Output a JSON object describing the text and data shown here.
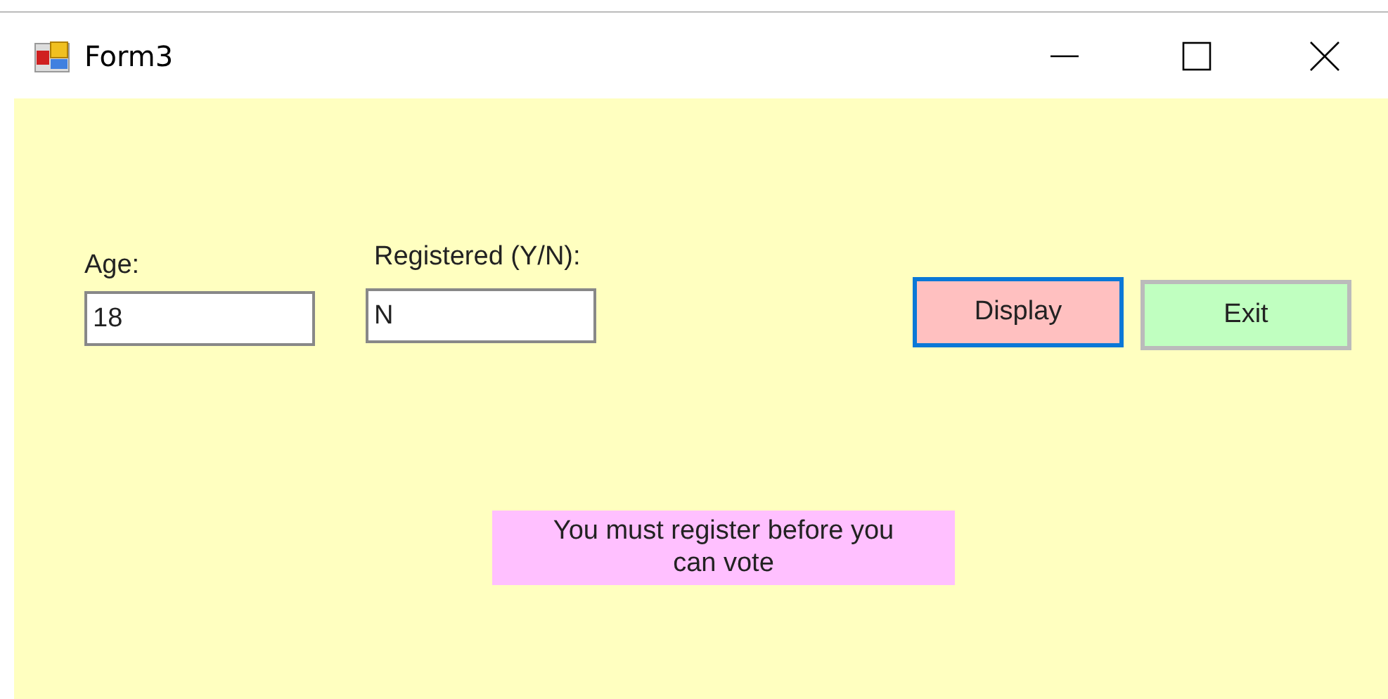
{
  "window": {
    "title": "Form3"
  },
  "fields": [
    {
      "label": "Age:",
      "value": "18"
    },
    {
      "label": "Registered (Y/N):",
      "value": "N"
    }
  ],
  "buttons": [
    {
      "label": "Display",
      "focused": true,
      "color": "#ffc0c0"
    },
    {
      "label": "Exit",
      "focused": false,
      "color": "#c0ffc0"
    }
  ],
  "message": {
    "text": "You must register before you can vote",
    "color": "#ffc0ff"
  }
}
